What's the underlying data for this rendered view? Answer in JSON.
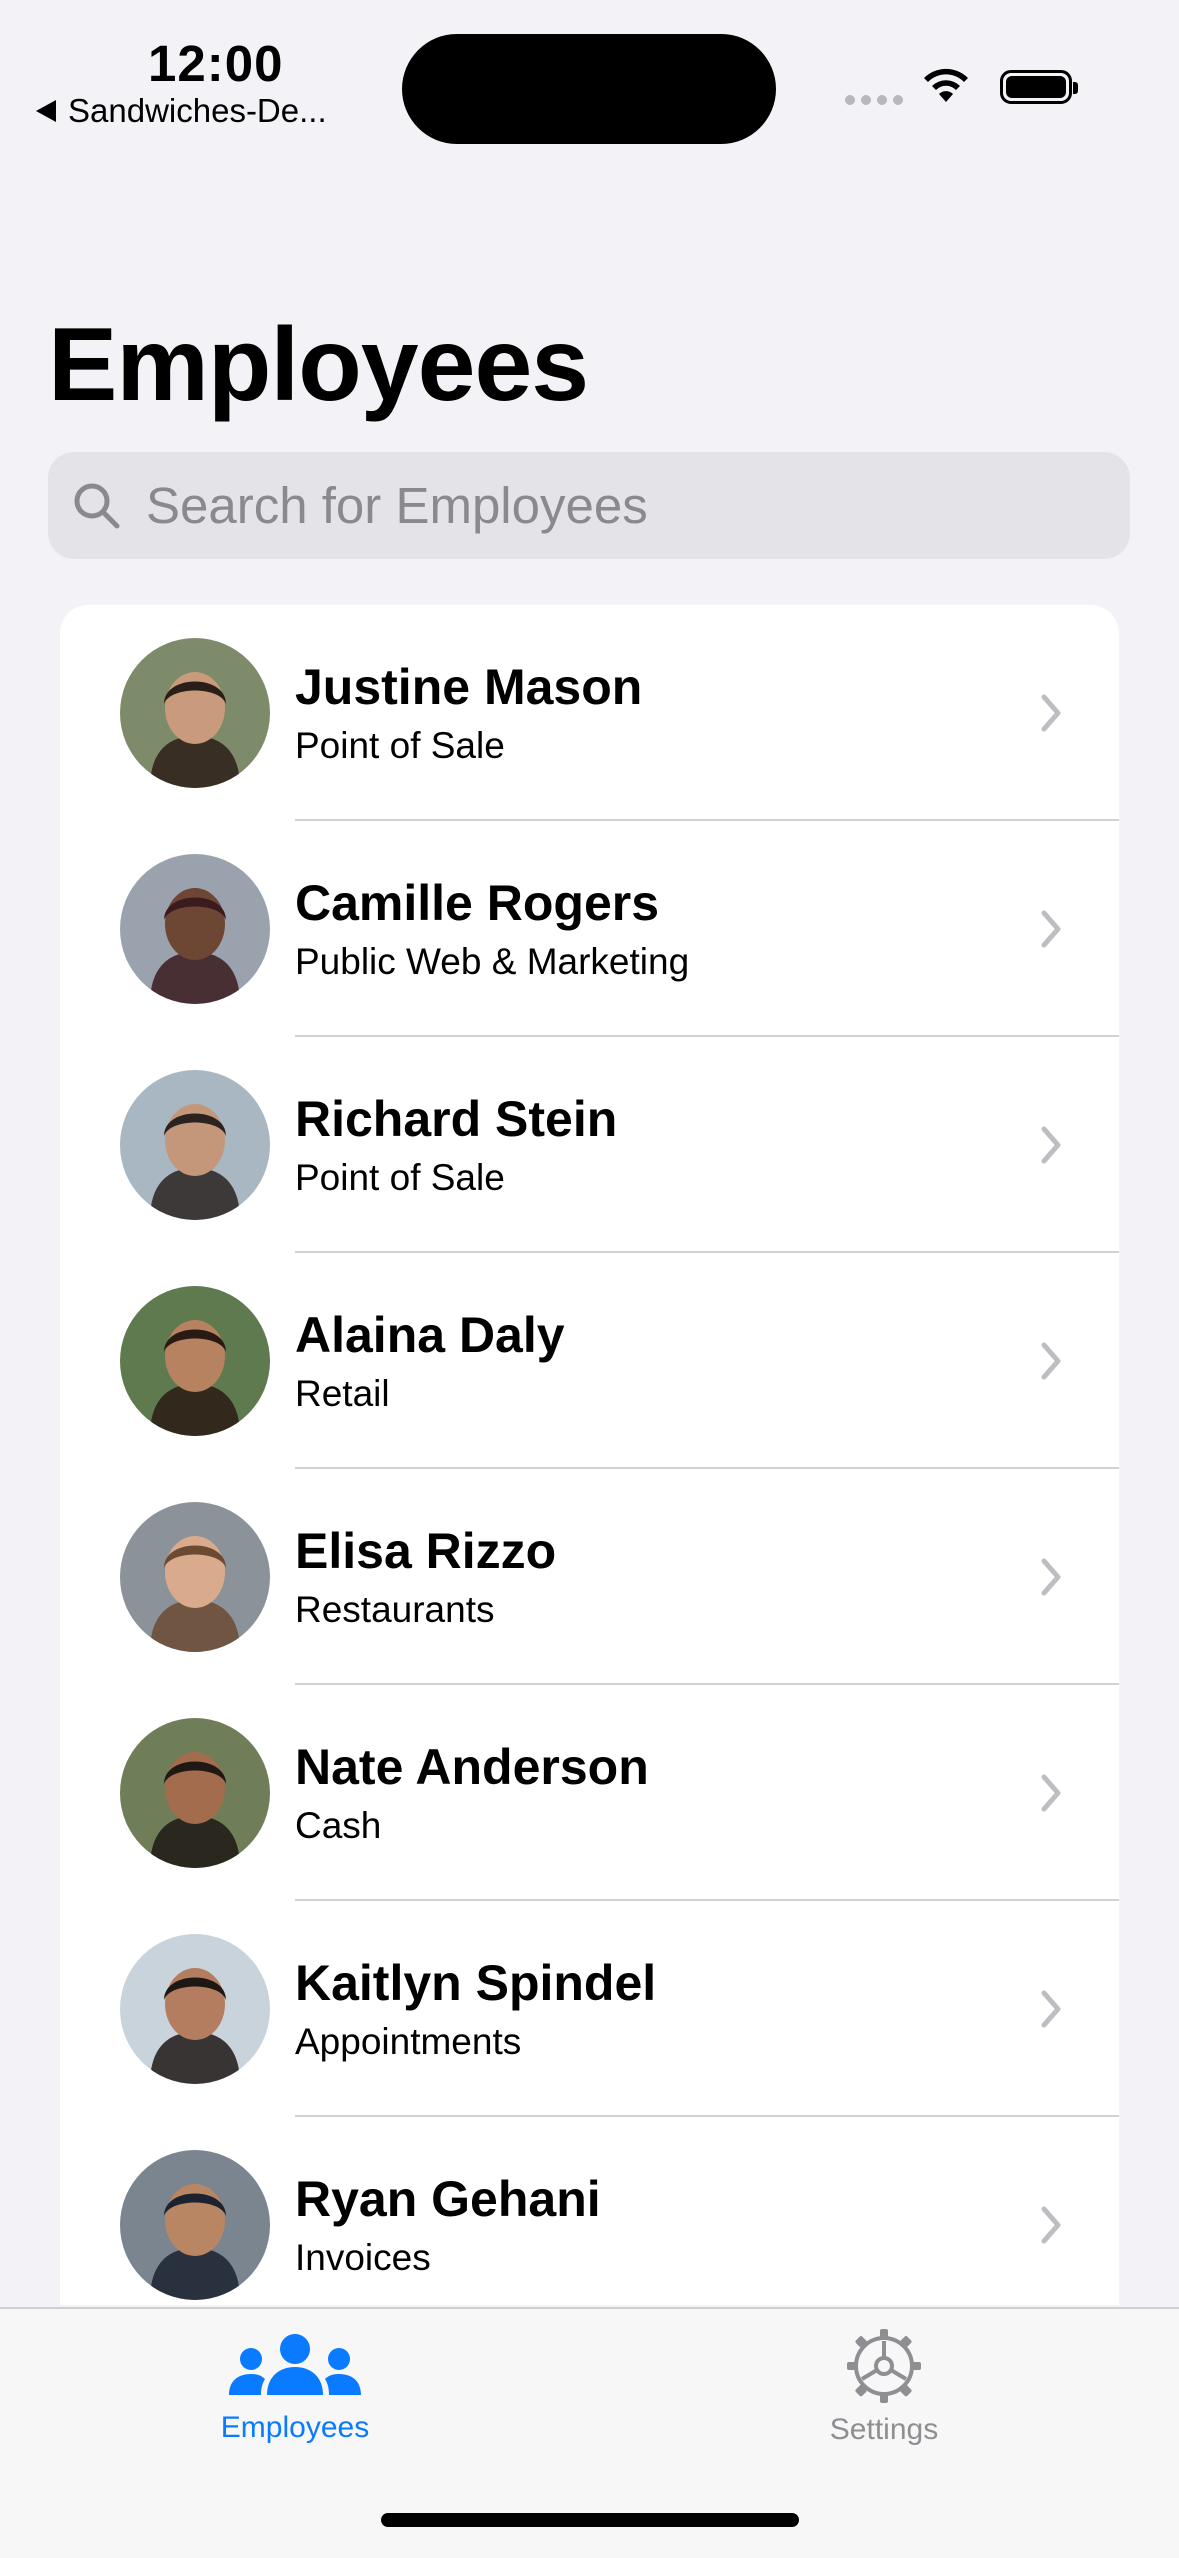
{
  "status_bar": {
    "time": "12:00",
    "back_app": "Sandwiches-De..."
  },
  "title": "Employees",
  "search": {
    "placeholder": "Search for Employees"
  },
  "employees": [
    {
      "name": "Justine Mason",
      "department": "Point of Sale"
    },
    {
      "name": "Camille Rogers",
      "department": "Public Web & Marketing"
    },
    {
      "name": "Richard Stein",
      "department": "Point of Sale"
    },
    {
      "name": "Alaina Daly",
      "department": "Retail"
    },
    {
      "name": "Elisa Rizzo",
      "department": "Restaurants"
    },
    {
      "name": "Nate Anderson",
      "department": "Cash"
    },
    {
      "name": "Kaitlyn Spindel",
      "department": "Appointments"
    },
    {
      "name": "Ryan Gehani",
      "department": "Invoices"
    }
  ],
  "tab_bar": {
    "tabs": [
      {
        "label": "Employees",
        "icon": "people-icon",
        "selected": true
      },
      {
        "label": "Settings",
        "icon": "gear-icon",
        "selected": false
      }
    ]
  },
  "colors": {
    "accent": "#0A7AFF",
    "background": "#F2F2F7",
    "inactive": "#8E8E93"
  }
}
